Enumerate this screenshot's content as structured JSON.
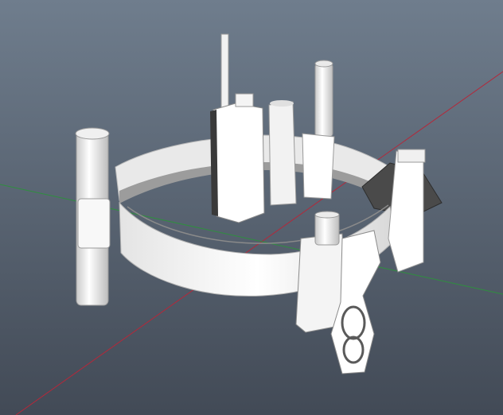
{
  "scene": {
    "viewport_background_top": "#6f7d8d",
    "viewport_background_bottom": "#424a56",
    "axis_x_color": "#b4283a",
    "axis_z_color": "#2f8f3f",
    "model_color": "#ffffff",
    "model_shade": "#cfcfcf",
    "model_dark": "#6b6b6b",
    "model_name_icon": "utility-belt-icon"
  }
}
